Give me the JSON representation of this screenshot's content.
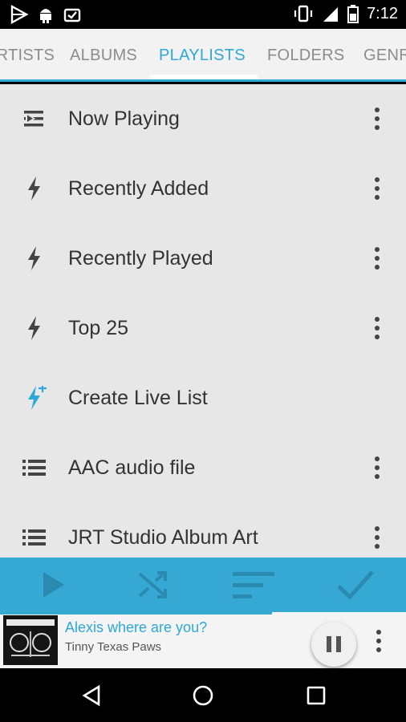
{
  "status_bar": {
    "time": "7:12",
    "left_icons": [
      "play-store-icon",
      "android-debug-icon",
      "download-done-icon"
    ],
    "right_icons": [
      "vibrate-icon",
      "signal-icon",
      "battery-icon"
    ]
  },
  "tabs": [
    {
      "label": "ARTISTS",
      "active": false
    },
    {
      "label": "ALBUMS",
      "active": false
    },
    {
      "label": "PLAYLISTS",
      "active": true
    },
    {
      "label": "FOLDERS",
      "active": false
    },
    {
      "label": "GENRES",
      "active": false
    }
  ],
  "playlists": [
    {
      "label": "Now Playing",
      "icon": "now-playing-icon",
      "has_menu": true
    },
    {
      "label": "Recently Added",
      "icon": "bolt-icon",
      "has_menu": true
    },
    {
      "label": "Recently Played",
      "icon": "bolt-icon",
      "has_menu": true
    },
    {
      "label": "Top 25",
      "icon": "bolt-icon",
      "has_menu": true
    },
    {
      "label": "Create Live List",
      "icon": "bolt-plus-icon",
      "has_menu": false
    },
    {
      "label": "AAC audio file",
      "icon": "list-icon",
      "has_menu": true
    },
    {
      "label": "JRT Studio Album Art",
      "icon": "list-icon",
      "has_menu": true
    }
  ],
  "action_bar": [
    "play-icon",
    "shuffle-icon",
    "sort-icon",
    "check-icon"
  ],
  "now_playing": {
    "title": "Alexis where are you?",
    "artist": "Tinny Texas Paws",
    "progress": 0.67
  },
  "colors": {
    "accent": "#2ea8d6",
    "action_bar": "#35a9d4",
    "list_bg": "#e7e7e7",
    "tab_bg": "#f2f2f2"
  }
}
